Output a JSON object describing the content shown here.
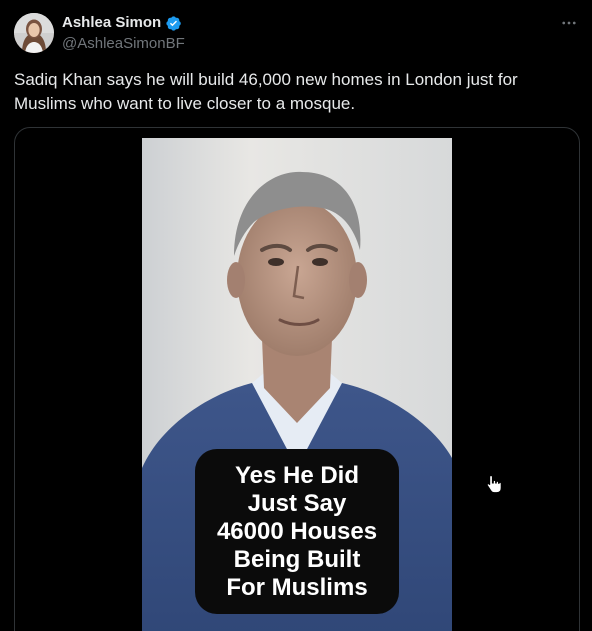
{
  "author": {
    "display_name": "Ashlea Simon",
    "handle": "@AshleaSimonBF",
    "verified": true,
    "verified_color": "#1d9bf0"
  },
  "tweet": {
    "text": "Sadiq Khan says he will build 46,000 new homes in London just for Muslims who want to live closer to a mosque."
  },
  "media": {
    "type": "video",
    "caption_overlay": "Yes He Did\nJust Say\n46000 Houses\nBeing Built\nFor Muslims"
  },
  "icons": {
    "more": "more-icon",
    "verified": "verified-badge-icon",
    "cursor": "hand-pointer-icon"
  },
  "colors": {
    "background": "#000000",
    "text_primary": "#e7e9ea",
    "text_secondary": "#71767b",
    "border": "#2f3336"
  }
}
